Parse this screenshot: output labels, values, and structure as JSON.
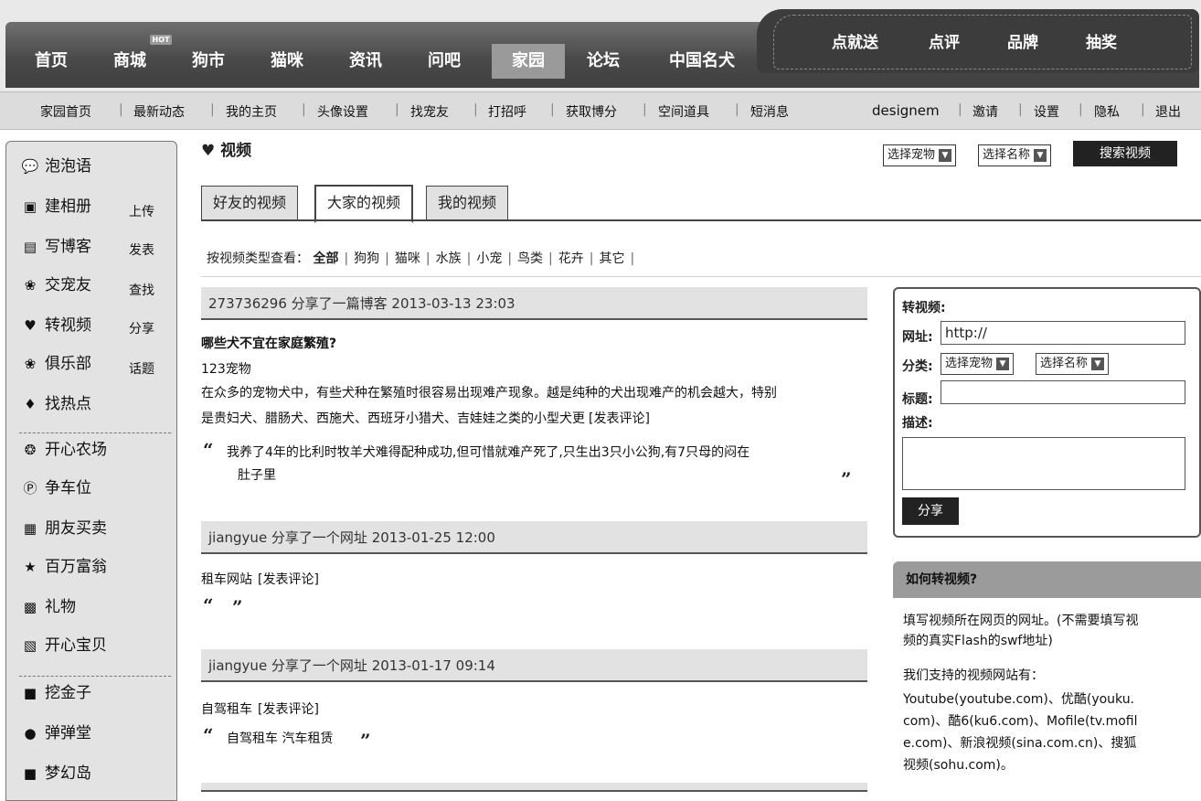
{
  "main_nav": {
    "items": [
      "首页",
      "商城",
      "狗市",
      "猫咪",
      "资讯",
      "问吧",
      "家园",
      "论坛",
      "中国名犬"
    ],
    "active": "家园",
    "hot_badge": "HOT",
    "right_items": [
      "点就送",
      "点评",
      "品牌",
      "抽奖"
    ]
  },
  "sub_nav": {
    "left_items": [
      "家园首页",
      "最新动态",
      "我的主页",
      "头像设置",
      "找宠友",
      "打招呼",
      "获取博分",
      "空间道具",
      "短消息"
    ],
    "right_items": [
      "designem",
      "邀请",
      "设置",
      "隐私",
      "退出"
    ]
  },
  "sidebar": {
    "items": [
      {
        "icon": "speech-bubble-icon",
        "label": "泡泡语",
        "extra": ""
      },
      {
        "icon": "photo-album-icon",
        "label": "建相册",
        "extra": "上传"
      },
      {
        "icon": "blog-icon",
        "label": "写博客",
        "extra": "发表"
      },
      {
        "icon": "pet-friend-icon",
        "label": "交宠友",
        "extra": "查找"
      },
      {
        "icon": "video-icon",
        "label": "转视频",
        "extra": "分享"
      },
      {
        "icon": "club-icon",
        "label": "俱乐部",
        "extra": "话题"
      },
      {
        "icon": "hot-icon",
        "label": "找热点",
        "extra": ""
      }
    ],
    "apps": [
      {
        "icon": "farm-icon",
        "label": "开心农场"
      },
      {
        "icon": "parking-icon",
        "label": "争车位"
      },
      {
        "icon": "trade-icon",
        "label": "朋友买卖"
      },
      {
        "icon": "star-icon",
        "label": "百万富翁"
      },
      {
        "icon": "gift-icon",
        "label": "礼物"
      },
      {
        "icon": "baby-icon",
        "label": "开心宝贝"
      }
    ],
    "games": [
      {
        "icon": "gold-icon",
        "label": "挖金子"
      },
      {
        "icon": "bounce-icon",
        "label": "弹弹堂"
      },
      {
        "icon": "island-icon",
        "label": "梦幻岛"
      }
    ]
  },
  "page": {
    "title": "视频",
    "select_pet": "选择宠物",
    "select_name": "选择名称",
    "search_button": "搜索视频",
    "tabs": [
      "好友的视频",
      "大家的视频",
      "我的视频"
    ],
    "active_tab": "大家的视频",
    "filter_label": "按视频类型查看：",
    "filter_options": [
      "全部",
      "狗狗",
      "猫咪",
      "水族",
      "小宠",
      "鸟类",
      "花卉",
      "其它"
    ]
  },
  "feed": [
    {
      "header": "273736296 分享了一篇博客  2013-03-13 23:03",
      "title": "哪些犬不宜在家庭繁殖?",
      "source": "123宠物",
      "body_line1": "在众多的宠物犬中，有些犬种在繁殖时很容易出现难产现象。越是纯种的犬出现难产的机会越大，特别",
      "body_line2": "是贵妇犬、腊肠犬、西施犬、西班牙小猎犬、吉娃娃之类的小型犬更",
      "comment_link": "[发表评论]",
      "quote_line1": "我养了4年的比利时牧羊犬难得配种成功,但可惜就难产死了,只生出3只小公狗,有7只母的闷在",
      "quote_line2": "肚子里"
    },
    {
      "header": "jiangyue 分享了一个网址  2013-01-25 12:00",
      "body": "租车网站",
      "comment_link": "[发表评论]",
      "quote": ""
    },
    {
      "header": "jiangyue 分享了一个网址  2013-01-17 09:14",
      "body": "自驾租车",
      "comment_link": "[发表评论]",
      "quote": "自驾租车 汽车租赁"
    }
  ],
  "share_panel": {
    "title": "转视频:",
    "url_label": "网址:",
    "url_value": "http://",
    "category_label": "分类:",
    "select_pet": "选择宠物",
    "select_name": "选择名称",
    "title_label": "标题:",
    "desc_label": "描述:",
    "share_button": "分享"
  },
  "howto": {
    "header": "如何转视频?",
    "para1_line1": "填写视频所在网页的网址。(不需要填写视",
    "para1_line2": "频的真实Flash的swf地址)",
    "para2_title": "我们支持的视频网站有：",
    "para2_line1": "Youtube(youtube.com)、优酷(youku.",
    "para2_line2": "com)、酷6(ku6.com)、Mofile(tv.mofil",
    "para2_line3": "e.com)、新浪视频(sina.com.cn)、搜狐",
    "para2_line4": "视频(sohu.com)。"
  }
}
